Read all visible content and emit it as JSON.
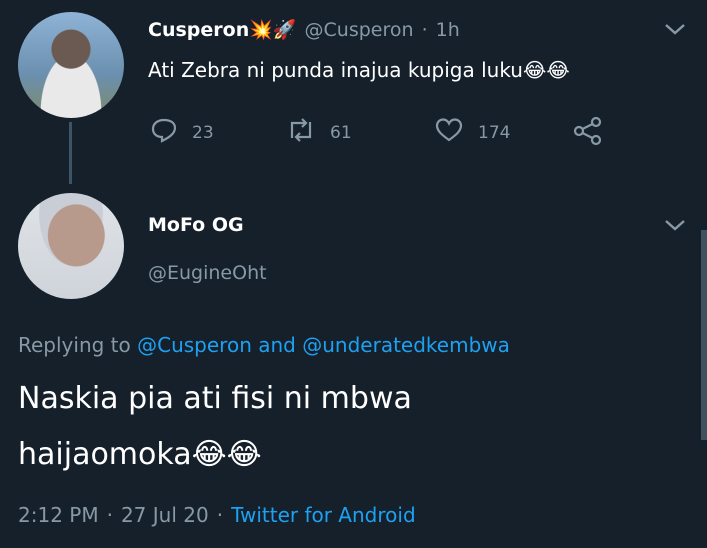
{
  "tweet1": {
    "name": "Cusperon💥🚀",
    "handle": "@Cusperon",
    "dot": "·",
    "time": "1h",
    "text": "Ati Zebra ni punda inajua kupiga luku😂😂",
    "replies": "23",
    "retweets": "61",
    "likes": "174"
  },
  "tweet2": {
    "name": "MoFo OG",
    "handle": "@EugineOht",
    "replying_prefix": "Replying to",
    "reply_user1": "@Cusperon",
    "reply_and": "and",
    "reply_user2": "@underatedkembwa",
    "text_line1": "Naskia pia ati fisi ni mbwa",
    "text_line2": "haijaomoka😂😂",
    "time": "2:12 PM",
    "sep": "·",
    "date": "27 Jul 20",
    "source": "Twitter for Android"
  },
  "icons": [
    "reply-icon",
    "retweet-icon",
    "like-icon",
    "share-icon",
    "chevron-down-icon"
  ],
  "colors": {
    "background": "#15202b",
    "muted": "#8899a6",
    "link": "#1da1f2"
  }
}
